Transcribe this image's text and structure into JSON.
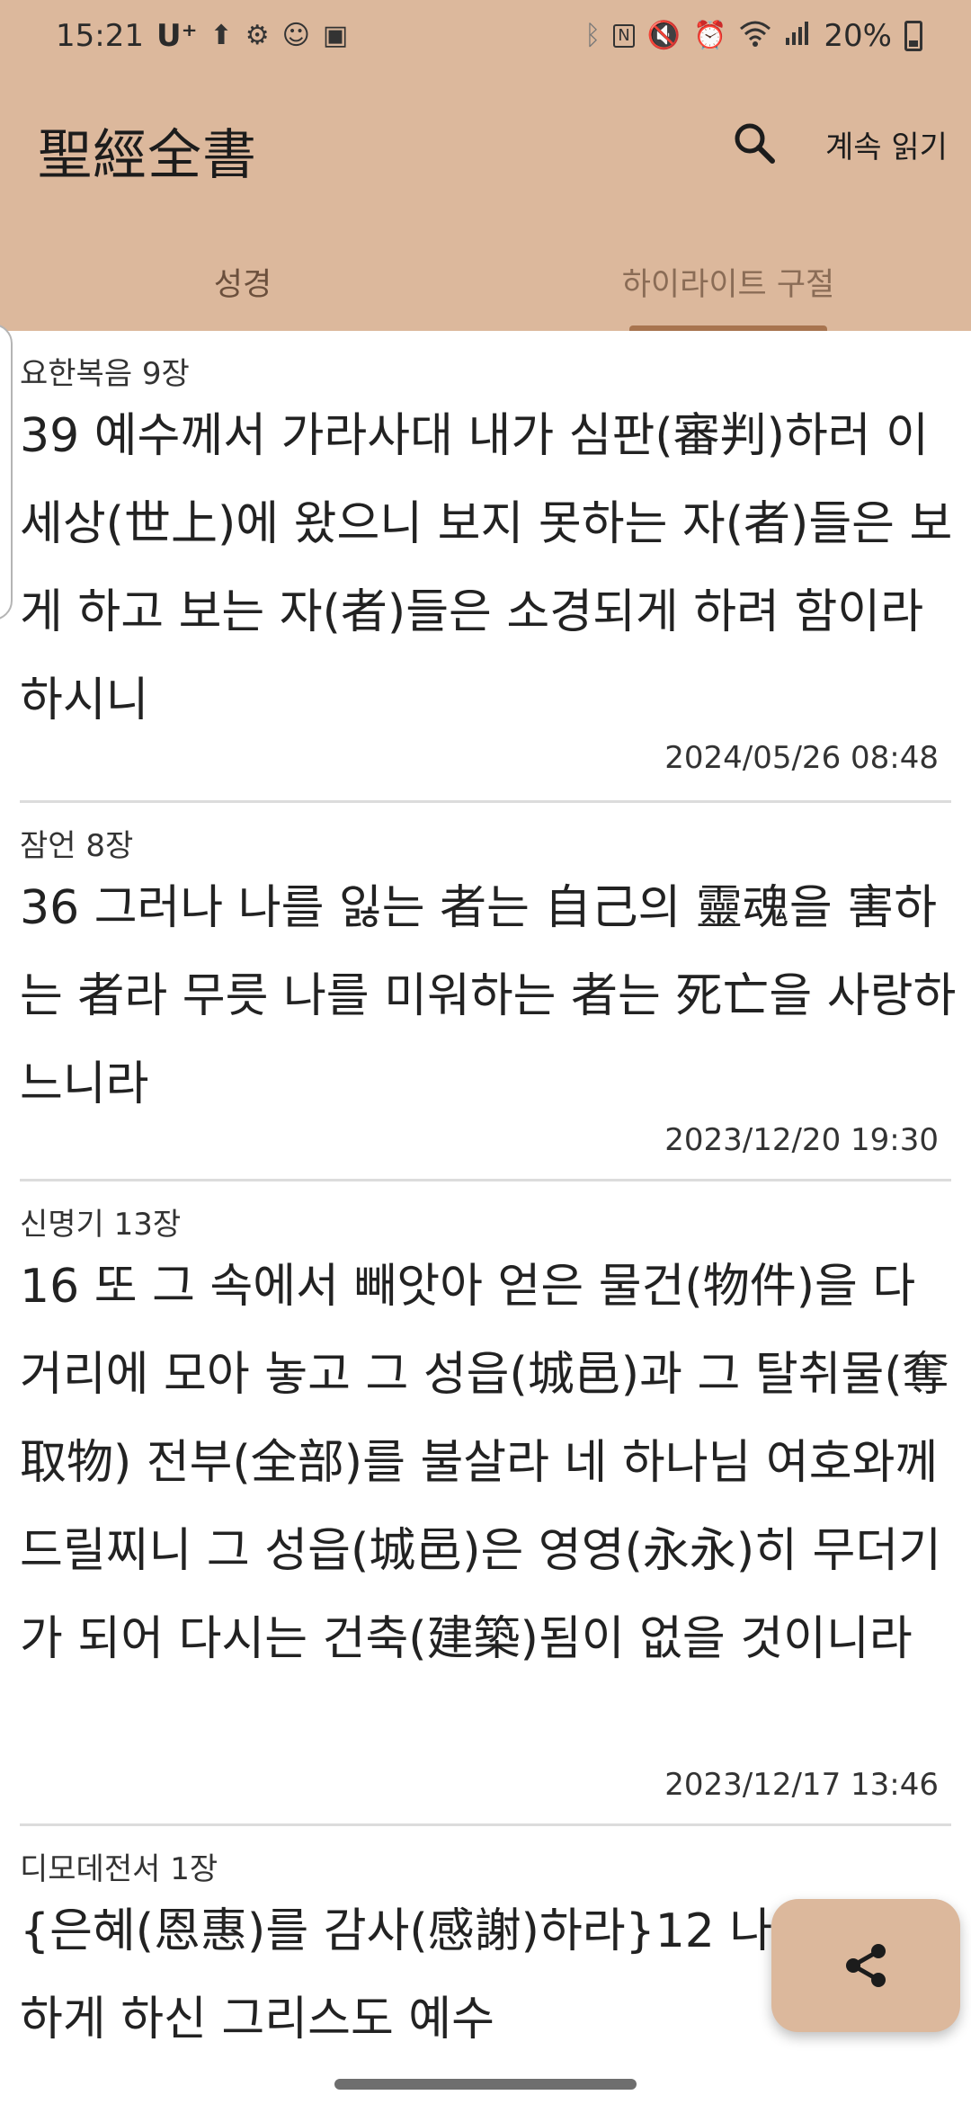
{
  "status_bar": {
    "time": "15:21",
    "carrier": "U⁺",
    "battery": "20%",
    "left_icons": [
      "upload-icon",
      "settings-icon",
      "face-icon",
      "phone-app-icon"
    ],
    "right_icons": [
      "bluetooth-icon",
      "nfc-icon",
      "mute-icon",
      "alarm-icon",
      "wifi-icon",
      "signal-icon",
      "battery-icon"
    ]
  },
  "app_bar": {
    "title": "聖經全書",
    "continue_label": "계속 읽기"
  },
  "tabs": [
    {
      "label": "성경",
      "selected": false
    },
    {
      "label": "하이라이트 구절",
      "selected": true
    }
  ],
  "highlights": [
    {
      "book": "요한복음 9장",
      "text": "39 예수께서 가라사대 내가 심판(審判)하러 이 세상(世上)에 왔으니 보지 못하는 자(者)들은 보게 하고 보는 자(者)들은 소경되게 하려 함이라 하시니",
      "date": "2024/05/26 08:48"
    },
    {
      "book": "잠언 8장",
      "text": "36 그러나 나를 잃는 者는 自己의 靈魂을 害하는 者라 무릇 나를 미워하는 者는 死亡을 사랑하느니라",
      "date": "2023/12/20 19:30"
    },
    {
      "book": "신명기 13장",
      "text": "16 또 그 속에서 빼앗아 얻은 물건(物件)을 다 거리에 모아 놓고 그 성읍(城邑)과 그 탈취물(奪取物) 전부(全部)를 불살라 네 하나님 여호와께 드릴찌니 그 성읍(城邑)은 영영(永永)히 무더기가 되어 다시는 건축(建築)됨이 없을 것이니라",
      "date": "2023/12/17 13:46"
    },
    {
      "book": "디모데전서 1장",
      "text": "{은혜(恩惠)를 감사(感謝)하라}12 나를 능(能)하게 하신 그리스도 예수",
      "date": ""
    }
  ],
  "fab": {
    "icon": "share-icon"
  },
  "colors": {
    "header_bg": "#dcb89c",
    "tab_indicator": "#a8744f",
    "divider": "#dcdcdc"
  }
}
